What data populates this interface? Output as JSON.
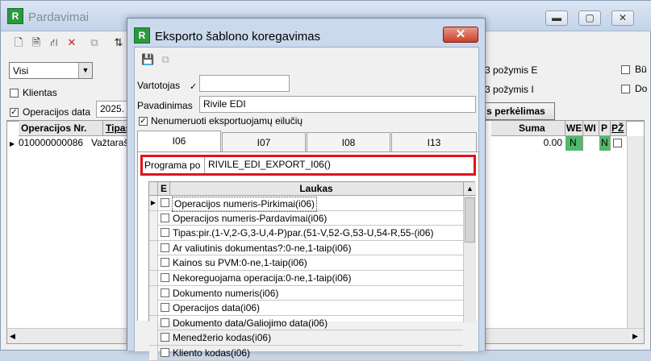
{
  "main": {
    "title": "Pardavimai",
    "app_icon": "R",
    "caption": {
      "minimize": "▬",
      "maximize": "▢",
      "close": "✕"
    },
    "filter_combo": {
      "value": "Visi"
    },
    "chk_klientas": {
      "label": "Klientas",
      "checked": false
    },
    "chk_opdata": {
      "label": "Operacijos data",
      "checked": true,
      "value": "2025."
    },
    "pozymis_e": "3 požymis E",
    "pozymis_i": "3 požymis I",
    "chk_bu": {
      "label": "Bū"
    },
    "chk_do": {
      "label": "Do"
    },
    "transfer_button": "s perkėlimas",
    "grid": {
      "columns": [
        "Operacijos Nr.",
        "Tipas",
        "Suma",
        "WE",
        "WI",
        "P",
        "PŽ"
      ],
      "rows": [
        {
          "nr": "010000000086",
          "tipas": "Važtarašt",
          "suma": "0.00",
          "we": "N",
          "p": "N"
        }
      ]
    }
  },
  "dialog": {
    "title": "Eksporto šablono koregavimas",
    "app_icon": "R",
    "close": "✕",
    "vartotojas_label": "Vartotojas",
    "vartotojas_value": "",
    "pavadinimas_label": "Pavadinimas",
    "pavadinimas_value": "Rivile EDI",
    "nenumeruoti_label": "Nenumeruoti eksportuojamų eilučių",
    "nenumeruoti_checked": true,
    "tabs": [
      "I06",
      "I07",
      "I08",
      "I13"
    ],
    "programa_label": "Programa po",
    "programa_value": "RIVILE_EDI_EXPORT_I06()",
    "list_header_e": "E",
    "list_header_laukas": "Laukas",
    "fields": [
      "Operacijos numeris-Pirkimai(i06)",
      "Operacijos numeris-Pardavimai(i06)",
      "Tipas:pir.(1-V,2-G,3-U,4-P)par.(51-V,52-G,53-U,54-R,55-(i06)",
      "Ar valiutinis dokumentas?:0-ne,1-taip(i06)",
      "Kainos su PVM:0-ne,1-taip(i06)",
      "Nekoreguojama operacija:0-ne,1-taip(i06)",
      "Dokumento numeris(i06)",
      "Operacijos data(i06)",
      "Dokumento data/Galiojimo data(i06)",
      "Menedžerio kodas(i06)",
      "Kliento kodas(i06)"
    ]
  }
}
